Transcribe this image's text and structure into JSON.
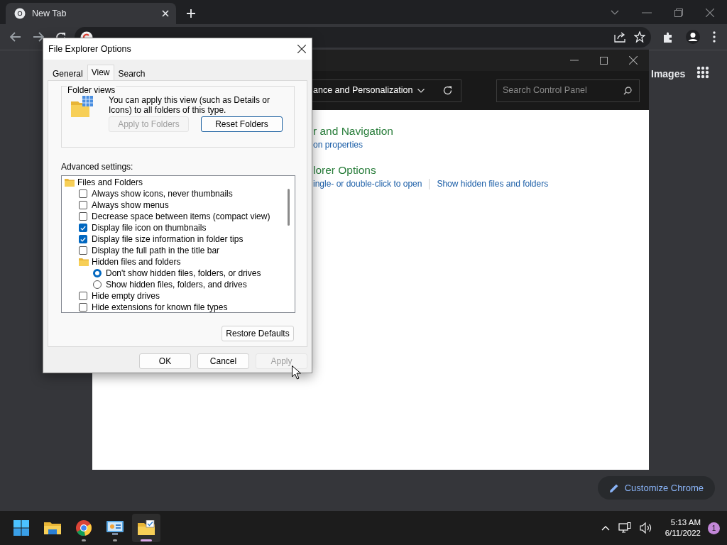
{
  "browser": {
    "tab": {
      "title": "New Tab",
      "selected": true
    },
    "page": {
      "images_link": "Images",
      "customize_button": "Customize Chrome"
    }
  },
  "control_panel": {
    "breadcrumb": "ance and Personalization",
    "search": {
      "placeholder": "Search Control Panel"
    },
    "sections": [
      {
        "heading": "r and Navigation",
        "links": [
          "on properties"
        ]
      },
      {
        "heading": "lorer Options",
        "links": [
          "ingle- or double-click to open",
          "Show hidden files and folders"
        ]
      }
    ]
  },
  "dialog": {
    "title": "File Explorer Options",
    "tabs": [
      {
        "label": "General",
        "selected": false
      },
      {
        "label": "View",
        "selected": true
      },
      {
        "label": "Search",
        "selected": false
      }
    ],
    "folder_views": {
      "label": "Folder views",
      "text": "You can apply this view (such as Details or Icons) to all folders of this type.",
      "buttons": [
        {
          "label": "Apply to Folders",
          "disabled": true,
          "focused": false
        },
        {
          "label": "Reset Folders",
          "disabled": false,
          "focused": true
        }
      ]
    },
    "advanced_label": "Advanced settings:",
    "tree": [
      {
        "kind": "folder",
        "label": "Files and Folders",
        "children": [
          {
            "kind": "checkbox",
            "label": "Always show icons, never thumbnails",
            "checked": false
          },
          {
            "kind": "checkbox",
            "label": "Always show menus",
            "checked": false
          },
          {
            "kind": "checkbox",
            "label": "Decrease space between items (compact view)",
            "checked": false
          },
          {
            "kind": "checkbox",
            "label": "Display file icon on thumbnails",
            "checked": true
          },
          {
            "kind": "checkbox",
            "label": "Display file size information in folder tips",
            "checked": true
          },
          {
            "kind": "checkbox",
            "label": "Display the full path in the title bar",
            "checked": false
          },
          {
            "kind": "folder",
            "label": "Hidden files and folders",
            "children": [
              {
                "kind": "radio",
                "label": "Don't show hidden files, folders, or drives",
                "selected": true
              },
              {
                "kind": "radio",
                "label": "Show hidden files, folders, and drives",
                "selected": false
              }
            ]
          },
          {
            "kind": "checkbox",
            "label": "Hide empty drives",
            "checked": false
          },
          {
            "kind": "checkbox",
            "label": "Hide extensions for known file types",
            "checked": false
          }
        ]
      }
    ],
    "restore_button": "Restore Defaults",
    "buttons": [
      {
        "label": "OK",
        "disabled": false
      },
      {
        "label": "Cancel",
        "disabled": false
      },
      {
        "label": "Apply",
        "disabled": true
      }
    ]
  },
  "taskbar": {
    "apps": [
      {
        "kind": "start",
        "running": false,
        "active": false
      },
      {
        "kind": "explorer",
        "running": false,
        "active": false
      },
      {
        "kind": "browser",
        "running": true,
        "active": false
      },
      {
        "kind": "control_panel",
        "running": true,
        "active": false
      },
      {
        "kind": "options",
        "running": true,
        "active": true
      }
    ],
    "clock": {
      "time": "5:13 AM",
      "date": "6/11/2022"
    },
    "notifications": "1"
  }
}
